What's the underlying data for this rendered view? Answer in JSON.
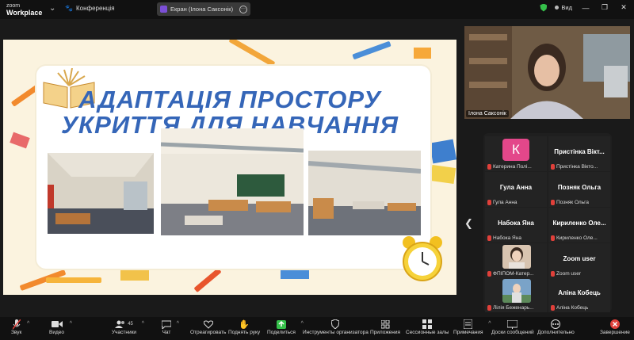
{
  "app": {
    "brand_top": "zoom",
    "brand_bottom": "Workplace"
  },
  "topbar": {
    "conference_label": "Конференція",
    "screen_share_label": "Екран (Ілона Саксонік)",
    "view_label": "Вид"
  },
  "slide": {
    "title_line1": "АДАПТАЦІЯ ПРОСТОРУ",
    "title_line2": "УКРИТТЯ ДЛЯ НАВЧАННЯ"
  },
  "speaker": {
    "name": "Ілона Саксонік"
  },
  "gallery": {
    "tiles": [
      {
        "display": "К",
        "caption": "Катерина Полі..."
      },
      {
        "display": "Пристінка Вікт...",
        "caption": "Пристінка Вікто..."
      },
      {
        "display": "Гула Анна",
        "caption": "Гула Анна"
      },
      {
        "display": "Позняк Ольга",
        "caption": "Позняк Ольга"
      },
      {
        "display": "Набока Яна",
        "caption": "Набока Яна"
      },
      {
        "display": "Кириленко Оле...",
        "caption": "Кириленко Оле..."
      },
      {
        "display": "",
        "caption": "ФПІПОМ-Катер..."
      },
      {
        "display": "Zoom user",
        "caption": "Zoom user"
      },
      {
        "display": "",
        "caption": "Лілія Беженарь..."
      },
      {
        "display": "Аліна Кобець",
        "caption": "Аліна Кобець"
      }
    ]
  },
  "toolbar": {
    "mute": "Звук",
    "video": "Видео",
    "participants": "Участники",
    "participants_count": "45",
    "chat": "Чат",
    "react": "Отреагировать",
    "raise_hand": "Поднять руку",
    "share": "Поделиться",
    "host_tools": "Инструменты организатора",
    "apps": "Приложения",
    "breakout": "Сессионные залы",
    "notes": "Примечания",
    "whiteboards": "Доски сообщений",
    "more": "Дополнительно",
    "end": "Завершение"
  },
  "colors": {
    "accent_green": "#35c04a",
    "slide_title": "#3566b8",
    "slide_bg": "#fbf3df",
    "avatar_pink": "#e3478a",
    "end_red": "#e0403a"
  }
}
